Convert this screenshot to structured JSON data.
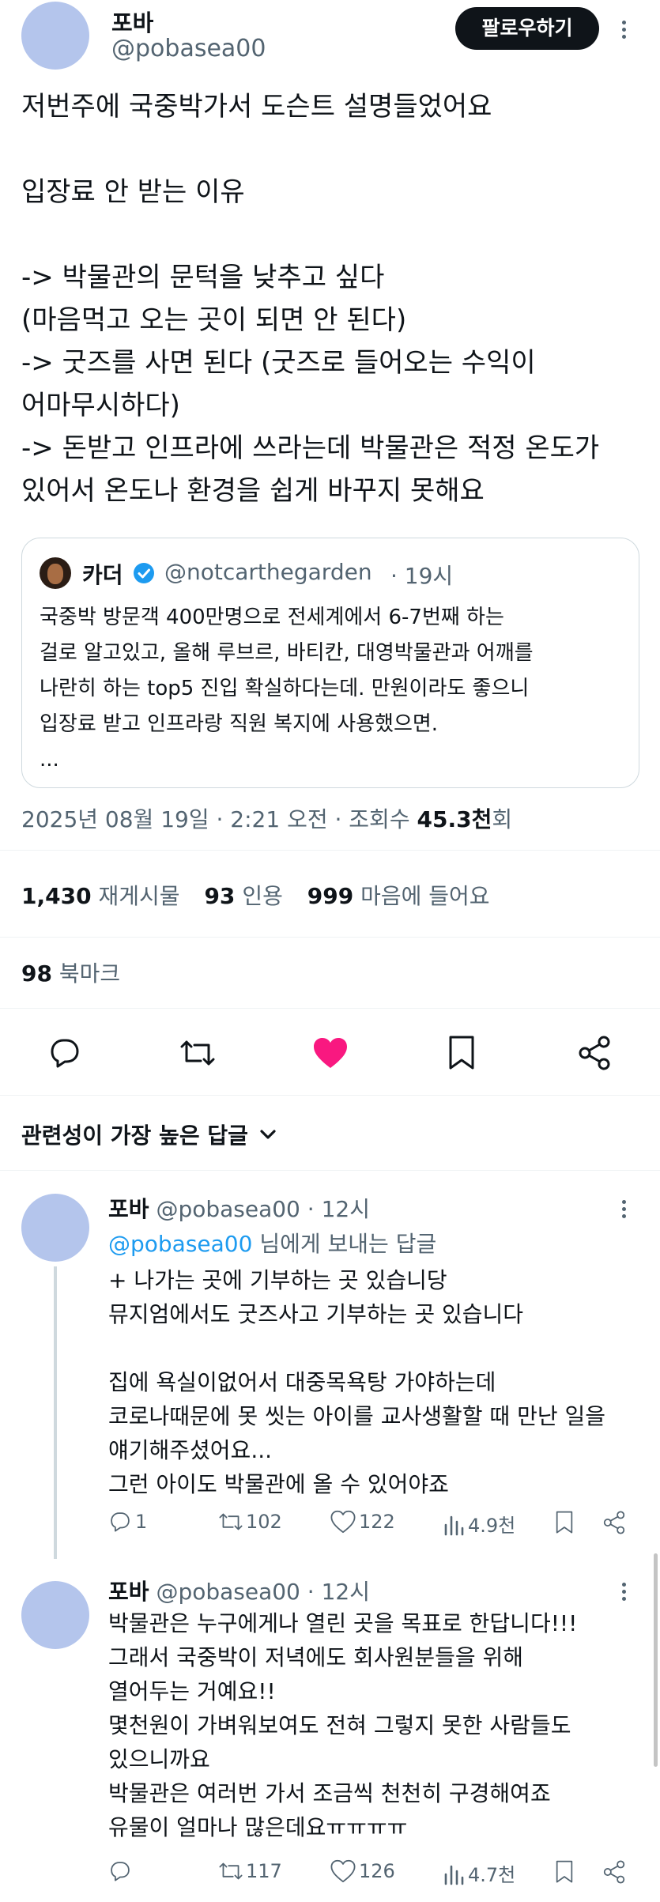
{
  "header": {
    "display_name": "포바",
    "handle": "@pobasea00",
    "follow_label": "팔로우하기"
  },
  "tweet": {
    "lines": [
      "저번주에 국중박가서 도슨트 설명들었어요",
      "",
      "입장료 안 받는 이유",
      "",
      "-> 박물관의 문턱을 낮추고 싶다",
      "(마음먹고 오는 곳이 되면 안 된다)",
      "-> 굿즈를 사면 된다 (굿즈로 들어오는 수익이",
      "어마무시하다)",
      "-> 돈받고 인프라에 쓰라는데 박물관은 적정 온도가",
      "있어서 온도나 환경을 쉽게 바꾸지 못해요"
    ],
    "quote": {
      "name": "카더",
      "handle": "@notcarthegarden",
      "time": "· 19시",
      "lines": [
        "국중박 방문객 400만명으로 전세계에서 6-7번째 하는",
        "걸로 알고있고, 올해 루브르, 바티칸, 대영박물관과 어깨를",
        "나란히 하는 top5 진입 확실하다는데. 만원이라도 좋으니",
        "입장료 받고 인프라랑 직원 복지에 사용했으면.",
        "..."
      ]
    },
    "timestamp": "2025년 08월 19일 · 2:21 오전 · 조회수 ",
    "views": "45.3천",
    "views_suffix": "회",
    "stats": {
      "retweets": "1,430",
      "retweets_label": "재게시물",
      "quotes": "93",
      "quotes_label": "인용",
      "likes": "999",
      "likes_label": "마음에 들어요",
      "bookmarks": "98",
      "bookmarks_label": "북마크"
    },
    "action_colors": {
      "like": "#f91880",
      "icon": "#536471"
    }
  },
  "sort": {
    "label": "관련성이 가장 높은 답글"
  },
  "replies": [
    {
      "name": "포바",
      "handle": "@pobasea00",
      "time": "· 12시",
      "replying_to": "@pobasea00",
      "replying_suffix": " 님에게 보내는 답글",
      "lines": [
        "+ 나가는 곳에 기부하는 곳 있습니당",
        "뮤지엄에서도 굿즈사고 기부하는 곳 있습니다",
        "",
        "집에 욕실이없어서 대중목욕탕 가야하는데",
        "코로나때문에 못 씻는 아이를 교사생활할 때 만난 일을",
        "얘기해주셨어요...",
        "그런 아이도 박물관에 올 수 있어야죠"
      ],
      "counts": {
        "reply": "1",
        "retweet": "102",
        "like": "122",
        "views": "4.9천"
      }
    },
    {
      "name": "포바",
      "handle": "@pobasea00",
      "time": "· 12시",
      "lines": [
        "박물관은 누구에게나 열린 곳을 목표로 한답니다!!!",
        "그래서 국중박이 저녁에도 회사원분들을 위해",
        "열어두는 거예요!!",
        "몇천원이 가벼워보여도 전혀 그렇지 못한 사람들도",
        "있으니까요",
        "박물관은 여러번 가서 조금씩 천천히 구경해여죠",
        "유물이 얼마나 많은데요ㅠㅠㅠㅠ"
      ],
      "counts": {
        "reply": "",
        "retweet": "117",
        "like": "126",
        "views": "4.7천"
      }
    }
  ]
}
